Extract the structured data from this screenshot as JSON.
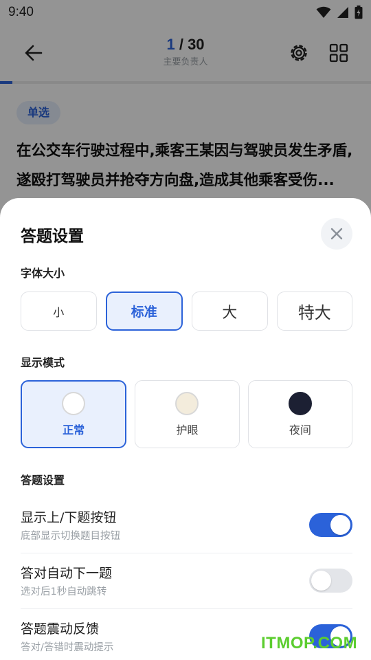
{
  "status_bar": {
    "time": "9:40",
    "icons": [
      "wifi-icon",
      "signal-icon",
      "battery-icon"
    ]
  },
  "header": {
    "back_icon": "arrow-left-icon",
    "progress_current": "1",
    "progress_separator": "/",
    "progress_total": "30",
    "subtitle": "主要负责人",
    "settings_icon": "gear-icon",
    "grid_icon": "grid-icon",
    "progress_fraction": 0.033
  },
  "question": {
    "type_badge": "单选",
    "text": "在公交车行驶过程中,乘客王某因与驾驶员发生矛盾,遂殴打驾驶员并抢夺方向盘,造成其他乘客受伤..."
  },
  "sheet": {
    "title": "答题设置",
    "close_icon": "close-icon",
    "font_size": {
      "label": "字体大小",
      "options": [
        "小",
        "标准",
        "大",
        "特大"
      ],
      "selected": "标准"
    },
    "display_mode": {
      "label": "显示模式",
      "options": [
        {
          "label": "正常",
          "swatch": "#ffffff"
        },
        {
          "label": "护眼",
          "swatch": "#f3ecdc"
        },
        {
          "label": "夜间",
          "swatch": "#1c2033"
        }
      ],
      "selected": "正常"
    },
    "answer_settings": {
      "label": "答题设置",
      "items": [
        {
          "title": "显示上/下题按钮",
          "desc": "底部显示切换题目按钮",
          "enabled": true
        },
        {
          "title": "答对自动下一题",
          "desc": "选对后1秒自动跳转",
          "enabled": false
        },
        {
          "title": "答题震动反馈",
          "desc": "答对/答错时震动提示",
          "enabled": true
        }
      ]
    }
  },
  "watermark": "ITMOP.COM",
  "colors": {
    "accent": "#2b62d9",
    "accent_light": "#e9f0fd",
    "scrim": "rgba(0,0,0,0.42)"
  }
}
